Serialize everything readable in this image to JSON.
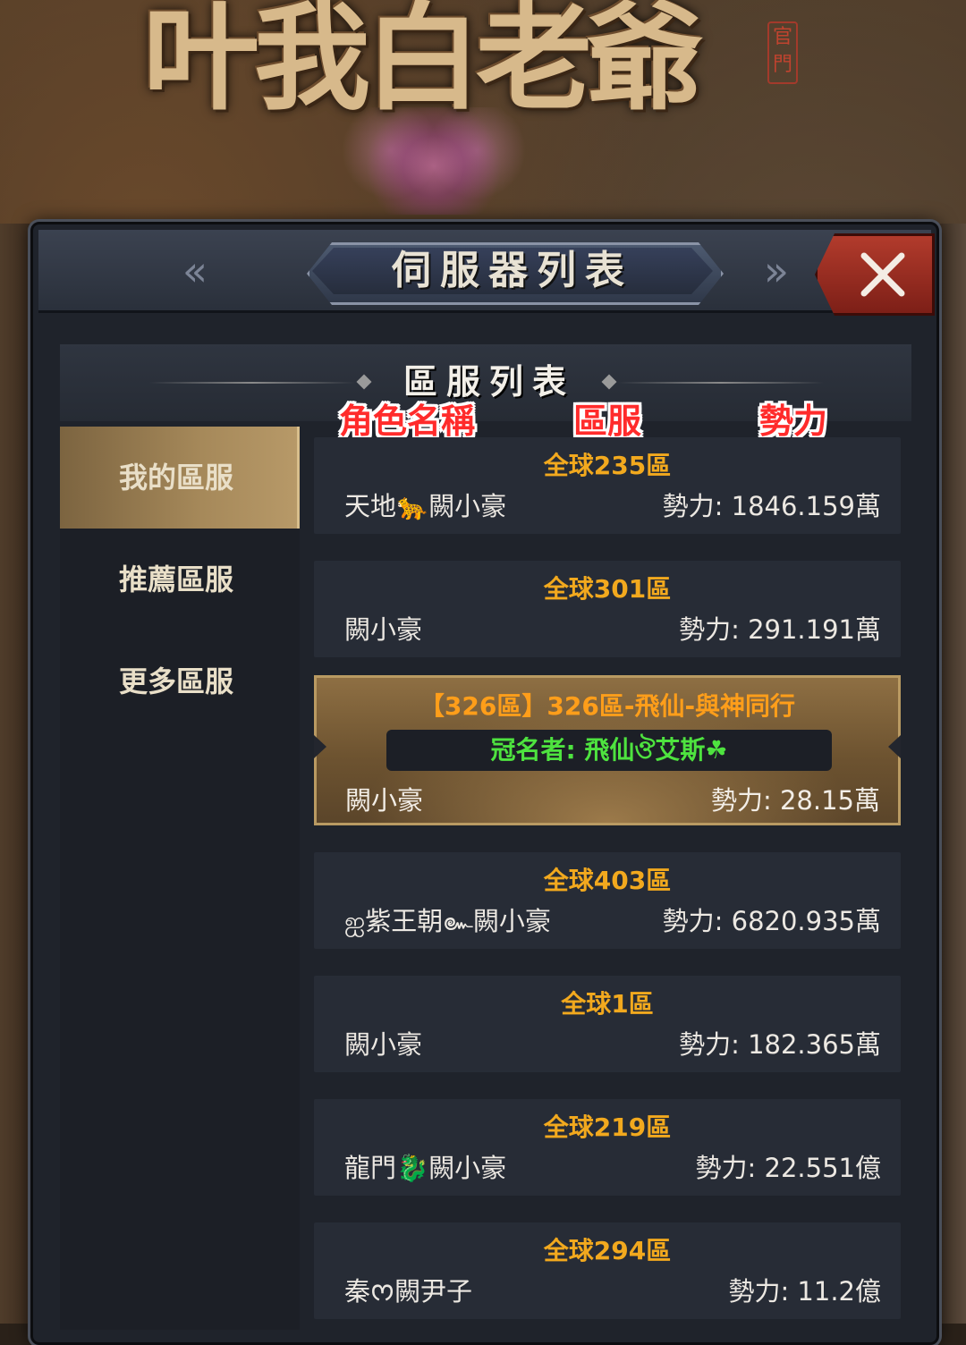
{
  "background": {
    "logo_text": "叶我白老爺",
    "seal_text": "官門"
  },
  "dialog": {
    "title": "伺服器列表",
    "section_title": "區服列表"
  },
  "annotations": {
    "role_name": "角色名稱",
    "server": "區服",
    "power": "勢力"
  },
  "sidebar": {
    "items": [
      {
        "label": "我的區服",
        "active": true
      },
      {
        "label": "推薦區服",
        "active": false
      },
      {
        "label": "更多區服",
        "active": false
      }
    ]
  },
  "servers": [
    {
      "zone": "全球235區",
      "role": "天地🐆闕小豪",
      "power": "勢力:  1846.159萬"
    },
    {
      "zone": "全球301區",
      "role": "闕小豪",
      "power": "勢力:  291.191萬"
    },
    {
      "zone": "【326區】326區-飛仙-與神同行",
      "crown": "冠名者:  飛仙ঔ艾斯☘",
      "role": "闕小豪",
      "power": "勢力:  28.15萬",
      "featured": true
    },
    {
      "zone": "全球403區",
      "role": "ஐ紫王朝๛闕小豪",
      "power": "勢力:  6820.935萬"
    },
    {
      "zone": "全球1區",
      "role": "闕小豪",
      "power": "勢力:  182.365萬"
    },
    {
      "zone": "全球219區",
      "role": "龍門🐉闕小豪",
      "power": "勢力:  22.551億"
    },
    {
      "zone": "全球294區",
      "role": "秦ᰔ闕尹子",
      "power": "勢力:  11.2億"
    }
  ],
  "colors": {
    "zone_text": "#f2a91e",
    "crown_text": "#4ee33f",
    "annotation_red": "#ff2b2b",
    "close_button": "#b23b2c"
  }
}
